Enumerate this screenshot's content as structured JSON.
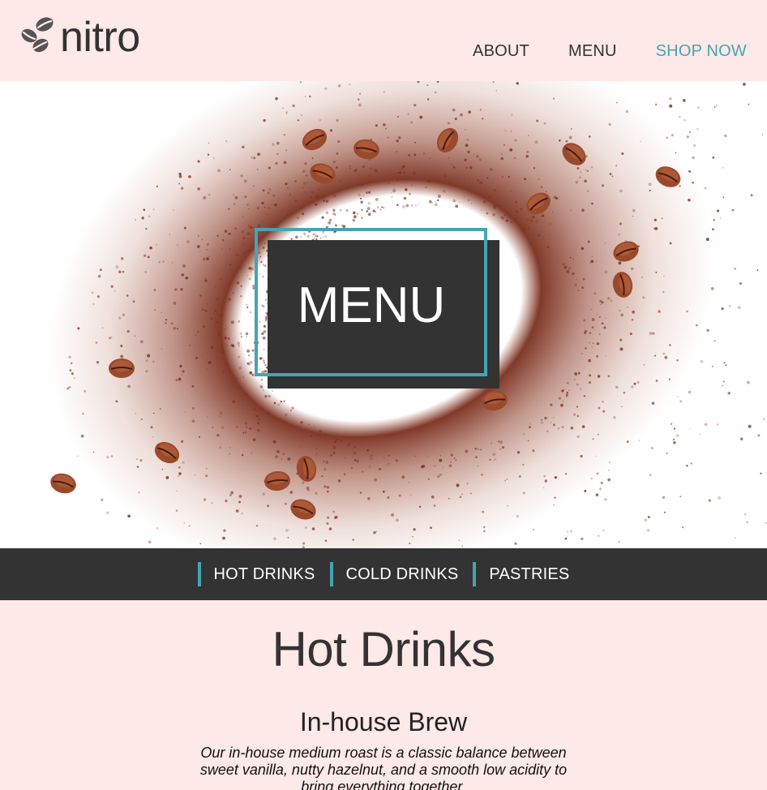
{
  "brand": {
    "name": "nitro",
    "logo_icon": "coffee-beans-icon"
  },
  "nav": {
    "items": [
      {
        "label": "ABOUT"
      },
      {
        "label": "MENU"
      },
      {
        "label": "SHOP NOW"
      }
    ]
  },
  "hero": {
    "title": "MENU"
  },
  "categories": [
    {
      "label": "HOT DRINKS"
    },
    {
      "label": "COLD DRINKS"
    },
    {
      "label": "PASTRIES"
    }
  ],
  "section": {
    "title": "Hot Drinks",
    "item": {
      "title": "In-house Brew",
      "description": "Our in-house medium roast is a classic balance between sweet vanilla, nutty hazelnut, and a smooth low acidity to bring everything together."
    }
  },
  "colors": {
    "accent": "#45a4b4",
    "dark": "#333333",
    "background": "#fde9e7",
    "coffee": "#8a3a26"
  }
}
